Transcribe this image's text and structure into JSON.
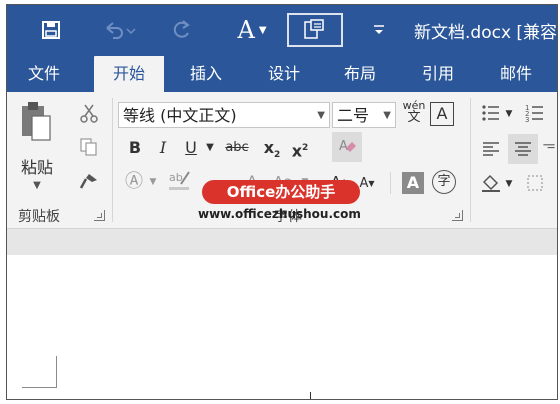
{
  "title_bar": {
    "document_title": "新文档.docx [兼容",
    "font_button_label": "A",
    "icons": [
      "save-icon",
      "undo-icon",
      "redo-icon",
      "touch-mode-icon",
      "customize-icon"
    ]
  },
  "tabs": [
    {
      "label": "文件"
    },
    {
      "label": "开始",
      "active": true
    },
    {
      "label": "插入"
    },
    {
      "label": "设计"
    },
    {
      "label": "布局"
    },
    {
      "label": "引用"
    },
    {
      "label": "邮件"
    }
  ],
  "clipboard": {
    "paste_label": "粘贴",
    "group_label": "剪贴板"
  },
  "font": {
    "font_name": "等线 (中文正文)",
    "font_size": "二号",
    "bold": "B",
    "italic": "I",
    "underline": "U",
    "strikethrough": "abc",
    "subscript": "x",
    "subscript_mark": "2",
    "superscript": "x",
    "superscript_mark": "2",
    "grow_font": "A",
    "shrink_font": "A",
    "change_case": "Aa",
    "char_shading": "A",
    "enclose": "字",
    "phonetic_top": "wén",
    "phonetic_bottom": "文",
    "char_border": "A",
    "group_label": "字体"
  },
  "watermark": {
    "brand": "Office办公助手",
    "url": "www.officezhushou.com"
  },
  "colors": {
    "ribbon_blue": "#2b579a",
    "ribbon_bg": "#f3f3f3",
    "watermark_red": "#d9332b"
  }
}
